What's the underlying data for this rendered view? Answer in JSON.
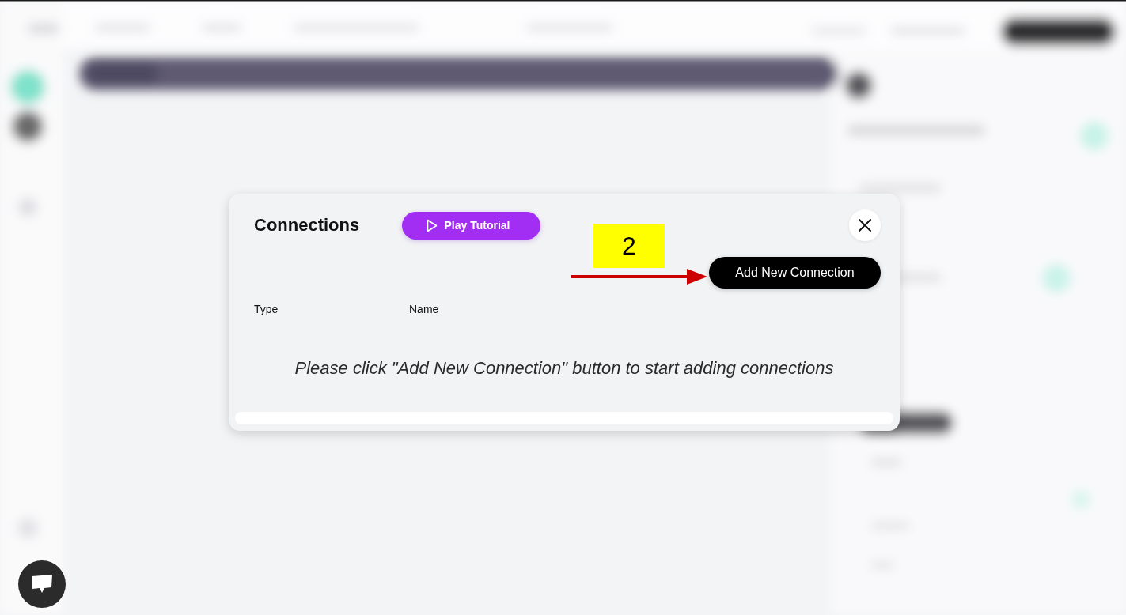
{
  "dialog": {
    "title": "Connections",
    "tutorial_button": "Play Tutorial",
    "add_button": "Add New Connection",
    "table": {
      "columns": [
        "Type",
        "Name"
      ],
      "empty_message": "Please click \"Add New Connection\" button to start adding connections"
    }
  },
  "annotation": {
    "step": "2"
  }
}
